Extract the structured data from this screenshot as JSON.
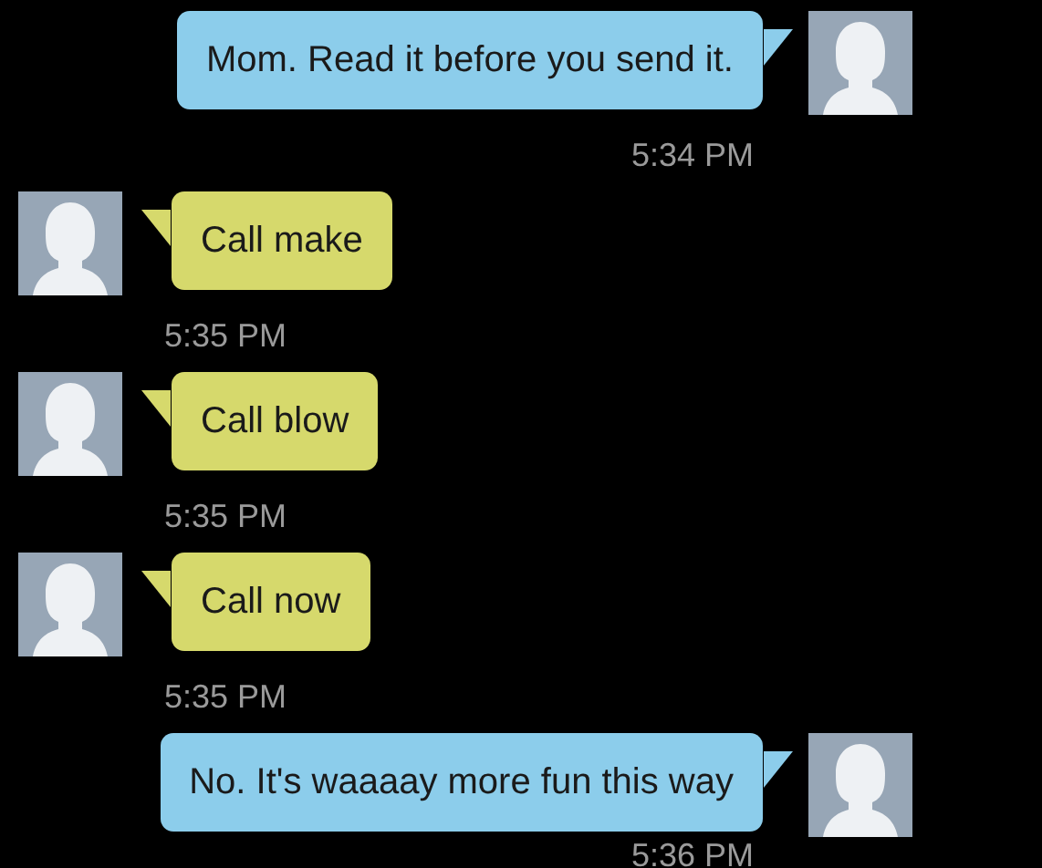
{
  "messages": [
    {
      "kind": "outgoing",
      "text": "Mom. Read it before you send it.",
      "time": "5:34 PM"
    },
    {
      "kind": "incoming",
      "text": "Call make",
      "time": "5:35 PM"
    },
    {
      "kind": "incoming",
      "text": "Call blow",
      "time": "5:35 PM"
    },
    {
      "kind": "incoming",
      "text": "Call now",
      "time": "5:35 PM"
    },
    {
      "kind": "outgoing",
      "text": "No. It's waaaay more fun this way",
      "time": "5:36 PM"
    }
  ]
}
